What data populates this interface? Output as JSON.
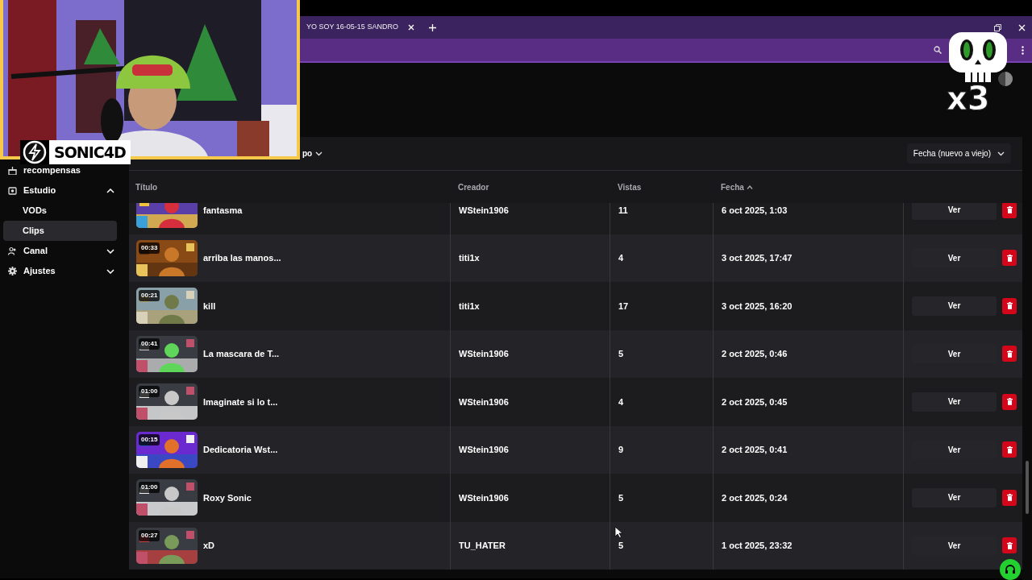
{
  "browser": {
    "tab": {
      "title": "YO SOY 16-05-15 SANDRO"
    }
  },
  "stream_overlay": {
    "streamer_name": "SONIC4D",
    "sticker_text": "x3"
  },
  "sidebar": {
    "items": [
      {
        "label": "recompensas",
        "kind": "link"
      },
      {
        "label": "Estudio",
        "kind": "section",
        "expanded": true,
        "children": [
          {
            "label": "VODs",
            "selected": false
          },
          {
            "label": "Clips",
            "selected": true
          }
        ]
      },
      {
        "label": "Canal",
        "kind": "section",
        "expanded": false
      },
      {
        "label": "Ajustes",
        "kind": "section",
        "expanded": false
      }
    ]
  },
  "filters": {
    "partial_dropdown": "po",
    "sort": "Fecha (nuevo a viejo)"
  },
  "table": {
    "columns": [
      {
        "label": "Título"
      },
      {
        "label": "Creador"
      },
      {
        "label": "Vistas"
      },
      {
        "label": "Fecha",
        "sorted": true,
        "ascending": true
      }
    ],
    "rows": [
      {
        "title": "fantasma",
        "creator": "WStein1906",
        "views": "11",
        "date": "6 oct 2025, 1:03",
        "action": "Ver"
      },
      {
        "title": "arriba las manos...",
        "duration": "00:33",
        "creator": "titi1x",
        "views": "4",
        "date": "3 oct 2025, 17:47",
        "action": "Ver"
      },
      {
        "title": "kill",
        "duration": "00:21",
        "creator": "titi1x",
        "views": "17",
        "date": "3 oct 2025, 16:20",
        "action": "Ver"
      },
      {
        "title": "La mascara de T...",
        "duration": "00:41",
        "creator": "WStein1906",
        "views": "5",
        "date": "2 oct 2025, 0:46",
        "action": "Ver"
      },
      {
        "title": "Imaginate si lo t...",
        "duration": "01:00",
        "creator": "WStein1906",
        "views": "4",
        "date": "2 oct 2025, 0:45",
        "action": "Ver"
      },
      {
        "title": "Dedicatoria Wst...",
        "duration": "00:15",
        "creator": "WStein1906",
        "views": "9",
        "date": "2 oct 2025, 0:41",
        "action": "Ver"
      },
      {
        "title": "Roxy Sonic",
        "duration": "01:00",
        "creator": "WStein1906",
        "views": "5",
        "date": "2 oct 2025, 0:24",
        "action": "Ver"
      },
      {
        "title": "xD",
        "duration": "00:27",
        "creator": "TU_HATER",
        "views": "5",
        "date": "1 oct 2025, 23:32",
        "action": "Ver"
      }
    ]
  }
}
